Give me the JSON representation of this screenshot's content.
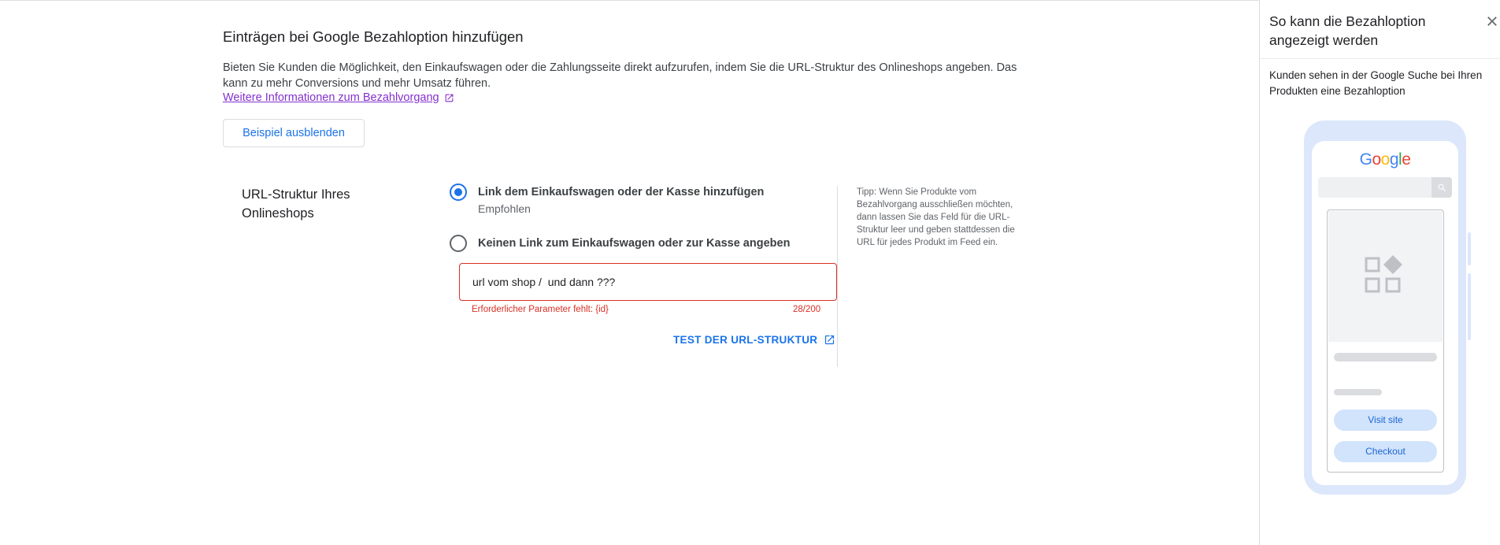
{
  "main": {
    "title": "Einträgen bei Google Bezahloption hinzufügen",
    "description": "Bieten Sie Kunden die Möglichkeit, den Einkaufswagen oder die Zahlungsseite direkt aufzurufen, indem Sie die URL-Struktur des Onlineshops angeben. Das kann zu mehr Conversions und mehr Umsatz führen.",
    "more_link": "Weitere Informationen zum Bezahlvorgang",
    "hide_example_button": "Beispiel ausblenden",
    "section_label": "URL-Struktur Ihres Onlineshops",
    "options": [
      {
        "label": "Link dem Einkaufswagen oder der Kasse hinzufügen",
        "sublabel": "Empfohlen",
        "selected": true
      },
      {
        "label": "Keinen Link zum Einkaufswagen oder zur Kasse angeben",
        "selected": false
      }
    ],
    "url_input_value": "url vom shop /  und dann ???",
    "error_text": "Erforderlicher Parameter fehlt: {id}",
    "char_count": "28/200",
    "test_link": "TEST DER URL-STRUKTUR",
    "tip": "Tipp: Wenn Sie Produkte vom Bezahlvorgang ausschließen möchten, dann lassen Sie das Feld für die URL-Struktur leer und geben stattdessen die URL für jedes Produkt im Feed ein."
  },
  "panel": {
    "title": "So kann die Bezahloption angezeigt werden",
    "description": "Kunden sehen in der Google Suche bei Ihren Produkten eine Bezahloption",
    "preview": {
      "logo_letters": [
        "G",
        "o",
        "o",
        "g",
        "l",
        "e"
      ],
      "logo_colors": [
        "#4285f4",
        "#ea4335",
        "#fbbc05",
        "#4285f4",
        "#34a853",
        "#ea4335"
      ],
      "visit_button": "Visit site",
      "checkout_button": "Checkout"
    }
  },
  "colors": {
    "accent": "#1a73e8",
    "error": "#d93025",
    "link_visited": "#8430ce"
  }
}
